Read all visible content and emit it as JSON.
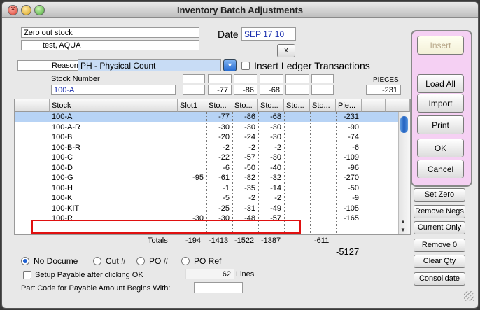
{
  "window": {
    "title": "Inventory Batch Adjustments"
  },
  "header": {
    "description": "Zero out stock",
    "user": "test, AQUA",
    "date_label": "Date",
    "date_value": "SEP 17 10",
    "x_button": "x",
    "reason_label": "Reason",
    "reason_value": "PH - Physical Count",
    "insert_ledger_label": "Insert Ledger Transactions",
    "stock_number_label": "Stock Number",
    "stock_number_value": "100-A",
    "pieces_label": "PIECES",
    "slot_values": [
      "",
      "-77",
      "-86",
      "-68",
      "",
      ""
    ],
    "pieces_value": "-231"
  },
  "table": {
    "columns": [
      "Stock",
      "Slot1",
      "Sto...",
      "Sto...",
      "Sto...",
      "Sto...",
      "Sto...",
      "Pie..."
    ],
    "rows": [
      [
        "100-A",
        "",
        "-77",
        "-86",
        "-68",
        "",
        "",
        "-231"
      ],
      [
        "100-A-R",
        "",
        "-30",
        "-30",
        "-30",
        "",
        "",
        "-90"
      ],
      [
        "100-B",
        "",
        "-20",
        "-24",
        "-30",
        "",
        "",
        "-74"
      ],
      [
        "100-B-R",
        "",
        "-2",
        "-2",
        "-2",
        "",
        "",
        "-6"
      ],
      [
        "100-C",
        "",
        "-22",
        "-57",
        "-30",
        "",
        "",
        "-109"
      ],
      [
        "100-D",
        "",
        "-6",
        "-50",
        "-40",
        "",
        "",
        "-96"
      ],
      [
        "100-G",
        "-95",
        "-61",
        "-82",
        "-32",
        "",
        "",
        "-270"
      ],
      [
        "100-H",
        "",
        "-1",
        "-35",
        "-14",
        "",
        "",
        "-50"
      ],
      [
        "100-K",
        "",
        "-5",
        "-2",
        "-2",
        "",
        "",
        "-9"
      ],
      [
        "100-KIT",
        "",
        "-25",
        "-31",
        "-49",
        "",
        "",
        "-105"
      ],
      [
        "100-R",
        "-30",
        "-30",
        "-48",
        "-57",
        "",
        "",
        "-165"
      ]
    ]
  },
  "totals": {
    "label": "Totals",
    "values": [
      "-194",
      "-1413",
      "-1522",
      "-1387",
      "",
      "-611",
      ""
    ],
    "grand": "-5127"
  },
  "options": {
    "radios": [
      "No Docume",
      "Cut #",
      "PO #",
      "PO Ref"
    ],
    "selected": "No Docume",
    "payable_label": "Setup Payable after clicking OK",
    "lines_count": "62",
    "lines_label": "Lines",
    "part_code_label": "Part Code for Payable Amount Begins With:"
  },
  "buttons": {
    "insert": "Insert",
    "load_all": "Load All",
    "import": "Import",
    "print": "Print",
    "ok": "OK",
    "cancel": "Cancel",
    "set_zero": "Set Zero",
    "remove_negs": "Remove Negs",
    "current_only": "Current Only",
    "remove_0": "Remove 0",
    "clear_qty": "Clear Qty",
    "consolidate": "Consolidate"
  },
  "colors": {
    "selection": "#b7d3f5",
    "highlight_box": "#e01010",
    "accent_blue": "#1a2fae",
    "panel_pink": "#f5d0f3"
  }
}
